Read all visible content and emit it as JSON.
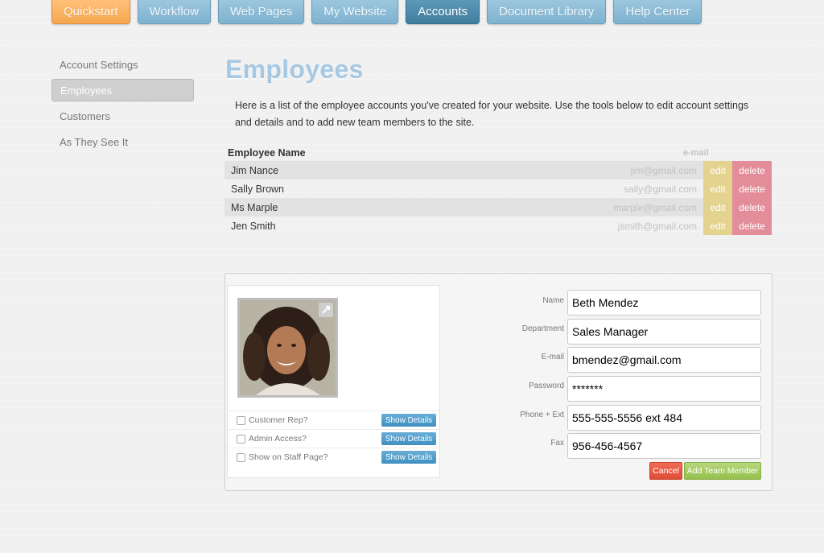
{
  "nav": {
    "tabs": [
      {
        "label": "Quickstart"
      },
      {
        "label": "Workflow"
      },
      {
        "label": "Web Pages"
      },
      {
        "label": "My Website"
      },
      {
        "label": "Accounts"
      },
      {
        "label": "Document Library"
      },
      {
        "label": "Help Center"
      }
    ],
    "active_tab": "Accounts"
  },
  "sidebar": {
    "items": [
      {
        "label": "Account Settings"
      },
      {
        "label": "Employees"
      },
      {
        "label": "Customers"
      },
      {
        "label": "As They See It"
      }
    ],
    "active_item": "Employees"
  },
  "main": {
    "title": "Employees",
    "intro": "Here is a list of the employee accounts you've created for your website. Use the tools below to edit account settings and details and to add new team members to the site."
  },
  "employees": {
    "columns": {
      "name": "Employee Name",
      "email": "e-mail"
    },
    "edit_label": "edit",
    "delete_label": "delete",
    "rows": [
      {
        "name": "Jim Nance",
        "email": "jim@gmail.com"
      },
      {
        "name": "Sally Brown",
        "email": "sally@gmail.com"
      },
      {
        "name": "Ms Marple",
        "email": "marple@gmail.com"
      },
      {
        "name": "Jen Smith",
        "email": "jsmith@gmail.com"
      }
    ]
  },
  "form": {
    "options": [
      {
        "label": "Customer Rep?",
        "button": "Show Details"
      },
      {
        "label": "Admin Access?",
        "button": "Show Details"
      },
      {
        "label": "Show on Staff Page?",
        "button": "Show Details"
      }
    ],
    "fields": [
      {
        "label": "Name",
        "value": "Beth Mendez"
      },
      {
        "label": "Department",
        "value": "Sales Manager"
      },
      {
        "label": "E-mail",
        "value": "bmendez@gmail.com"
      },
      {
        "label": "Password",
        "value": "*******"
      },
      {
        "label": "Phone + Ext",
        "value": "555-555-5556 ext 484"
      },
      {
        "label": "Fax",
        "value": "956-456-4567"
      }
    ],
    "cancel_label": "Cancel",
    "add_label": "Add Team Member"
  },
  "colors": {
    "accent_blue": "#7fb2cf",
    "active_blue": "#3f7d9f",
    "quickstart_orange": "#f5a64e",
    "edit_yellow": "#e4d28f",
    "delete_pink": "#e48d9a"
  }
}
